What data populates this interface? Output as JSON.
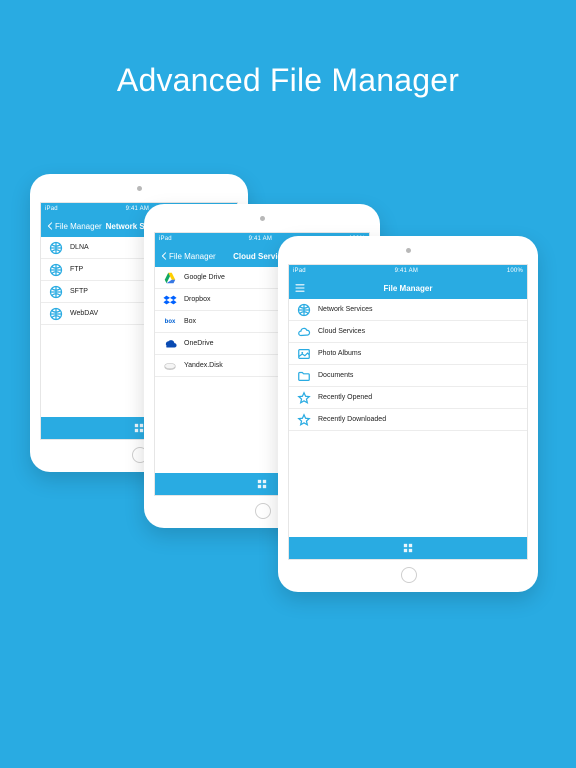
{
  "hero_title": "Advanced File Manager",
  "status": {
    "carrier": "iPad",
    "time": "9:41 AM",
    "battery": "100%"
  },
  "back_label": "File Manager",
  "accent_color": "#29abe2",
  "screens": {
    "network": {
      "title": "Network Services",
      "items": [
        {
          "label": "DLNA"
        },
        {
          "label": "FTP"
        },
        {
          "label": "SFTP"
        },
        {
          "label": "WebDAV"
        }
      ]
    },
    "cloud": {
      "title": "Cloud Services",
      "items": [
        {
          "label": "Google Drive"
        },
        {
          "label": "Dropbox"
        },
        {
          "label": "Box"
        },
        {
          "label": "OneDrive"
        },
        {
          "label": "Yandex.Disk"
        }
      ]
    },
    "root": {
      "title": "File Manager",
      "items": [
        {
          "label": "Network Services"
        },
        {
          "label": "Cloud Services"
        },
        {
          "label": "Photo Albums"
        },
        {
          "label": "Documents"
        },
        {
          "label": "Recently Opened"
        },
        {
          "label": "Recently Downloaded"
        }
      ]
    }
  }
}
